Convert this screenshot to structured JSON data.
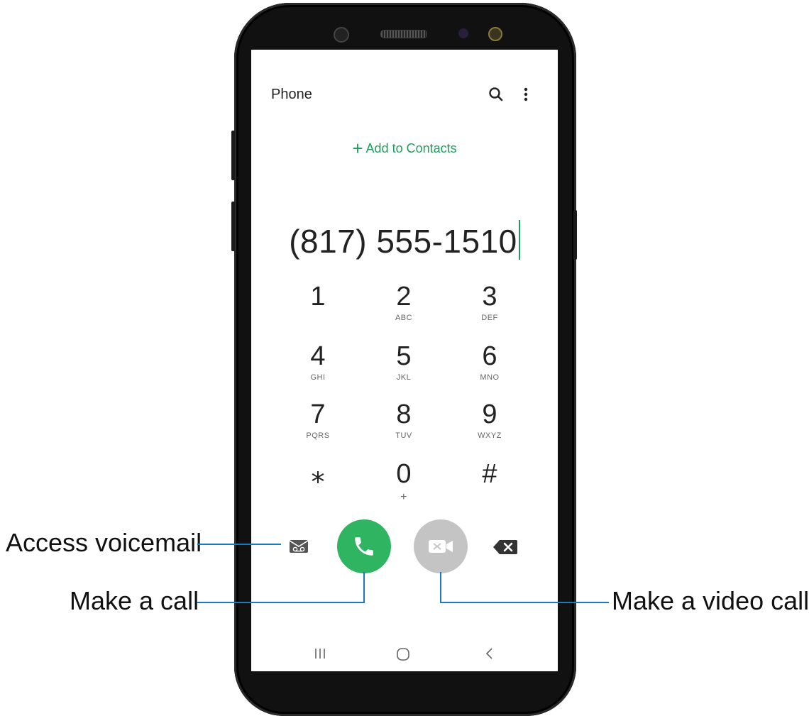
{
  "app": {
    "title": "Phone"
  },
  "toolbar": {
    "search_icon": "search-icon",
    "more_icon": "more-options-icon"
  },
  "add_contacts": {
    "label": "Add to Contacts",
    "icon": "plus-icon"
  },
  "dialed_number": "(817) 555-1510",
  "keypad": [
    {
      "digit": "1",
      "letters": ""
    },
    {
      "digit": "2",
      "letters": "ABC"
    },
    {
      "digit": "3",
      "letters": "DEF"
    },
    {
      "digit": "4",
      "letters": "GHI"
    },
    {
      "digit": "5",
      "letters": "JKL"
    },
    {
      "digit": "6",
      "letters": "MNO"
    },
    {
      "digit": "7",
      "letters": "PQRS"
    },
    {
      "digit": "8",
      "letters": "TUV"
    },
    {
      "digit": "9",
      "letters": "WXYZ"
    },
    {
      "digit": "⁎",
      "letters": ""
    },
    {
      "digit": "0",
      "letters": "+"
    },
    {
      "digit": "#",
      "letters": ""
    }
  ],
  "actions": {
    "voicemail_icon": "voicemail-icon",
    "call_icon": "phone-icon",
    "video_call_icon": "video-call-icon",
    "backspace_icon": "backspace-icon"
  },
  "nav_bar": {
    "recents_icon": "recent-apps-icon",
    "home_icon": "home-icon",
    "back_icon": "back-icon"
  },
  "annotations": {
    "voicemail": "Access voicemail",
    "call": "Make a call",
    "video": "Make a video call"
  },
  "colors": {
    "accent": "#1f9f5c",
    "call_button": "#2fb561",
    "video_button": "#c4c4c4",
    "callout_line": "#1c7bbf"
  }
}
